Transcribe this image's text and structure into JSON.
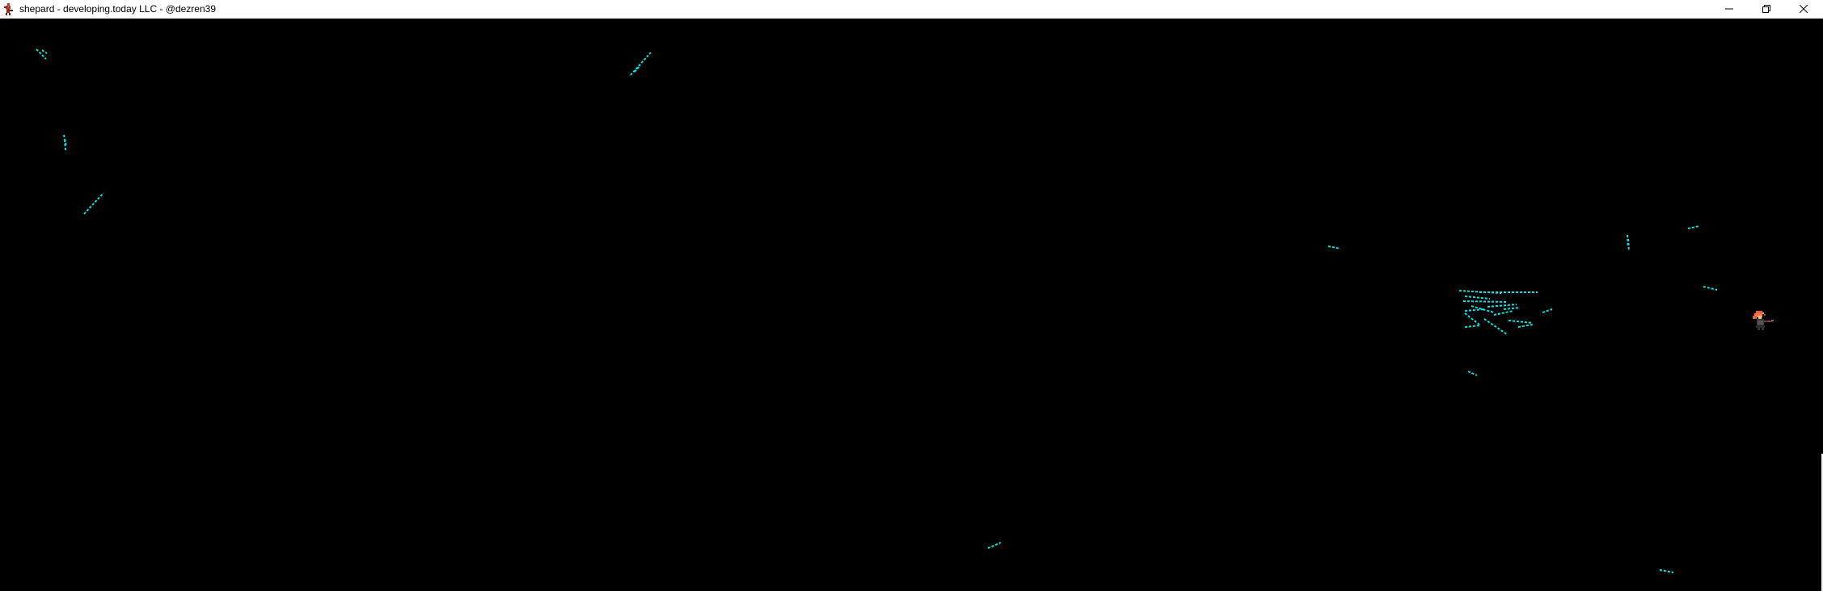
{
  "window": {
    "title": "shepard - developing.today LLC - @dezren39",
    "controls": {
      "minimize_icon": "minimize-icon",
      "restore_icon": "restore-icon",
      "close_icon": "close-icon"
    },
    "app_icon": "demon-sprite-icon"
  },
  "game": {
    "background_color": "#000000",
    "projectile_color": "#00e5e5",
    "player_colors": [
      "#e8623a",
      "#f2b24a",
      "#3a3a3a",
      "#7a3a4a"
    ]
  }
}
